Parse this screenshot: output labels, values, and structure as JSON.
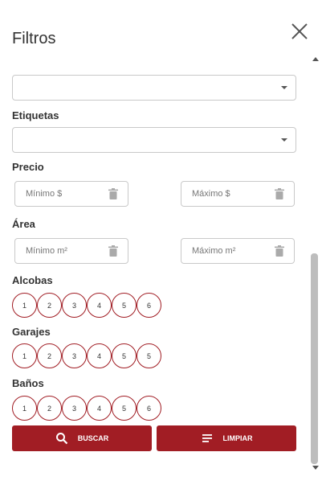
{
  "header": {
    "title": "Filtros"
  },
  "first_select": {
    "value": ""
  },
  "etiquetas": {
    "label": "Etiquetas",
    "value": ""
  },
  "precio": {
    "label": "Precio",
    "min_placeholder": "Mínimo $",
    "max_placeholder": "Máximo $"
  },
  "area": {
    "label": "Área",
    "min_placeholder": "Mínimo m²",
    "max_placeholder": "Máximo m²"
  },
  "alcobas": {
    "label": "Alcobas",
    "options": [
      "1",
      "2",
      "3",
      "4",
      "5",
      "6"
    ]
  },
  "garajes": {
    "label": "Garajes",
    "options": [
      "1",
      "2",
      "3",
      "4",
      "5",
      "5"
    ]
  },
  "banos": {
    "label": "Baños",
    "options": [
      "1",
      "2",
      "3",
      "4",
      "5",
      "6"
    ]
  },
  "buttons": {
    "search_label": "BUSCAR",
    "clear_label": "LIMPIAR"
  },
  "icons": {
    "close": "close-icon",
    "caret": "chevron-down-icon",
    "trash": "trash-icon",
    "search": "search-icon",
    "clear": "clear-lines-icon"
  },
  "colors": {
    "accent": "#a11d24",
    "border": "#c9c9c9"
  }
}
